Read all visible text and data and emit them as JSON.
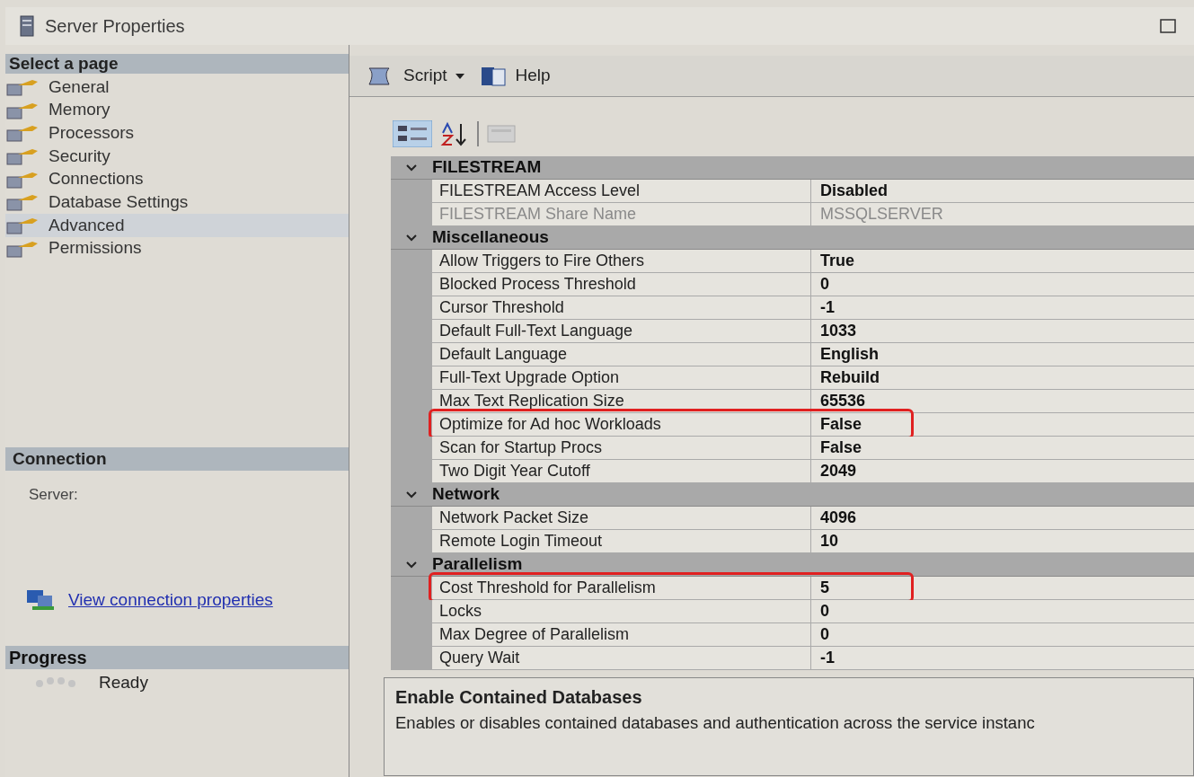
{
  "window": {
    "title": "Server Properties"
  },
  "sidebar": {
    "header": "Select a page",
    "items": [
      {
        "label": "General",
        "selected": false
      },
      {
        "label": "Memory",
        "selected": false
      },
      {
        "label": "Processors",
        "selected": false
      },
      {
        "label": "Security",
        "selected": false
      },
      {
        "label": "Connections",
        "selected": false
      },
      {
        "label": "Database Settings",
        "selected": false
      },
      {
        "label": "Advanced",
        "selected": true
      },
      {
        "label": "Permissions",
        "selected": false
      }
    ]
  },
  "connection": {
    "header": "Connection",
    "server_label": "Server:",
    "link": "View connection properties"
  },
  "progress": {
    "header": "Progress",
    "status": "Ready"
  },
  "toolbar": {
    "buttons": [
      "Script",
      "Help"
    ]
  },
  "property_grid": {
    "categories": [
      {
        "name": "FILESTREAM",
        "expanded": true,
        "rows": [
          {
            "name": "FILESTREAM Access Level",
            "value": "Disabled",
            "disabled": false,
            "highlighted": false
          },
          {
            "name": "FILESTREAM Share Name",
            "value": "MSSQLSERVER",
            "disabled": true,
            "highlighted": false
          }
        ]
      },
      {
        "name": "Miscellaneous",
        "expanded": true,
        "rows": [
          {
            "name": "Allow Triggers to Fire Others",
            "value": "True",
            "disabled": false,
            "highlighted": false
          },
          {
            "name": "Blocked Process Threshold",
            "value": "0",
            "disabled": false,
            "highlighted": false
          },
          {
            "name": "Cursor Threshold",
            "value": "-1",
            "disabled": false,
            "highlighted": false
          },
          {
            "name": "Default Full-Text Language",
            "value": "1033",
            "disabled": false,
            "highlighted": false
          },
          {
            "name": "Default Language",
            "value": "English",
            "disabled": false,
            "highlighted": false
          },
          {
            "name": "Full-Text Upgrade Option",
            "value": "Rebuild",
            "disabled": false,
            "highlighted": false
          },
          {
            "name": "Max Text Replication Size",
            "value": "65536",
            "disabled": false,
            "highlighted": false
          },
          {
            "name": "Optimize for Ad hoc Workloads",
            "value": "False",
            "disabled": false,
            "highlighted": true
          },
          {
            "name": "Scan for Startup Procs",
            "value": "False",
            "disabled": false,
            "highlighted": false
          },
          {
            "name": "Two Digit Year Cutoff",
            "value": "2049",
            "disabled": false,
            "highlighted": false
          }
        ]
      },
      {
        "name": "Network",
        "expanded": true,
        "rows": [
          {
            "name": "Network Packet Size",
            "value": "4096",
            "disabled": false,
            "highlighted": false
          },
          {
            "name": "Remote Login Timeout",
            "value": "10",
            "disabled": false,
            "highlighted": false
          }
        ]
      },
      {
        "name": "Parallelism",
        "expanded": true,
        "rows": [
          {
            "name": "Cost Threshold for Parallelism",
            "value": "5",
            "disabled": false,
            "highlighted": true
          },
          {
            "name": "Locks",
            "value": "0",
            "disabled": false,
            "highlighted": false
          },
          {
            "name": "Max Degree of Parallelism",
            "value": "0",
            "disabled": false,
            "highlighted": false
          },
          {
            "name": "Query Wait",
            "value": "-1",
            "disabled": false,
            "highlighted": false
          }
        ]
      }
    ]
  },
  "description": {
    "title": "Enable Contained Databases",
    "text": "Enables or disables contained databases and authentication across the service instanc"
  }
}
